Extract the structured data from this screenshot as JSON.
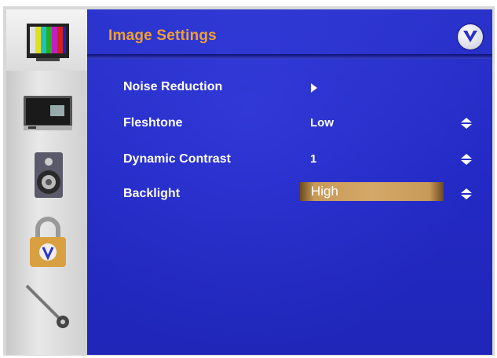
{
  "header": {
    "title": "Image Settings",
    "logo": "vizio-v-logo"
  },
  "sidebar": {
    "items": [
      {
        "icon": "tv-color-bars-icon",
        "selected": true
      },
      {
        "icon": "display-monitor-icon",
        "selected": false
      },
      {
        "icon": "speaker-icon",
        "selected": false
      },
      {
        "icon": "padlock-icon",
        "selected": false
      },
      {
        "icon": "wrench-icon",
        "selected": false
      }
    ]
  },
  "settings": [
    {
      "label": "Noise Reduction",
      "value": "",
      "control": "submenu-arrow"
    },
    {
      "label": "Fleshtone",
      "value": "Low",
      "control": "up-down"
    },
    {
      "label": "Dynamic Contrast",
      "value": "1",
      "control": "up-down"
    },
    {
      "label": "Backlight",
      "value": "High",
      "control": "up-down",
      "highlighted": true
    }
  ],
  "colors": {
    "title": "#f0a030",
    "background": "#2329c4",
    "highlight": "#d4a868"
  }
}
